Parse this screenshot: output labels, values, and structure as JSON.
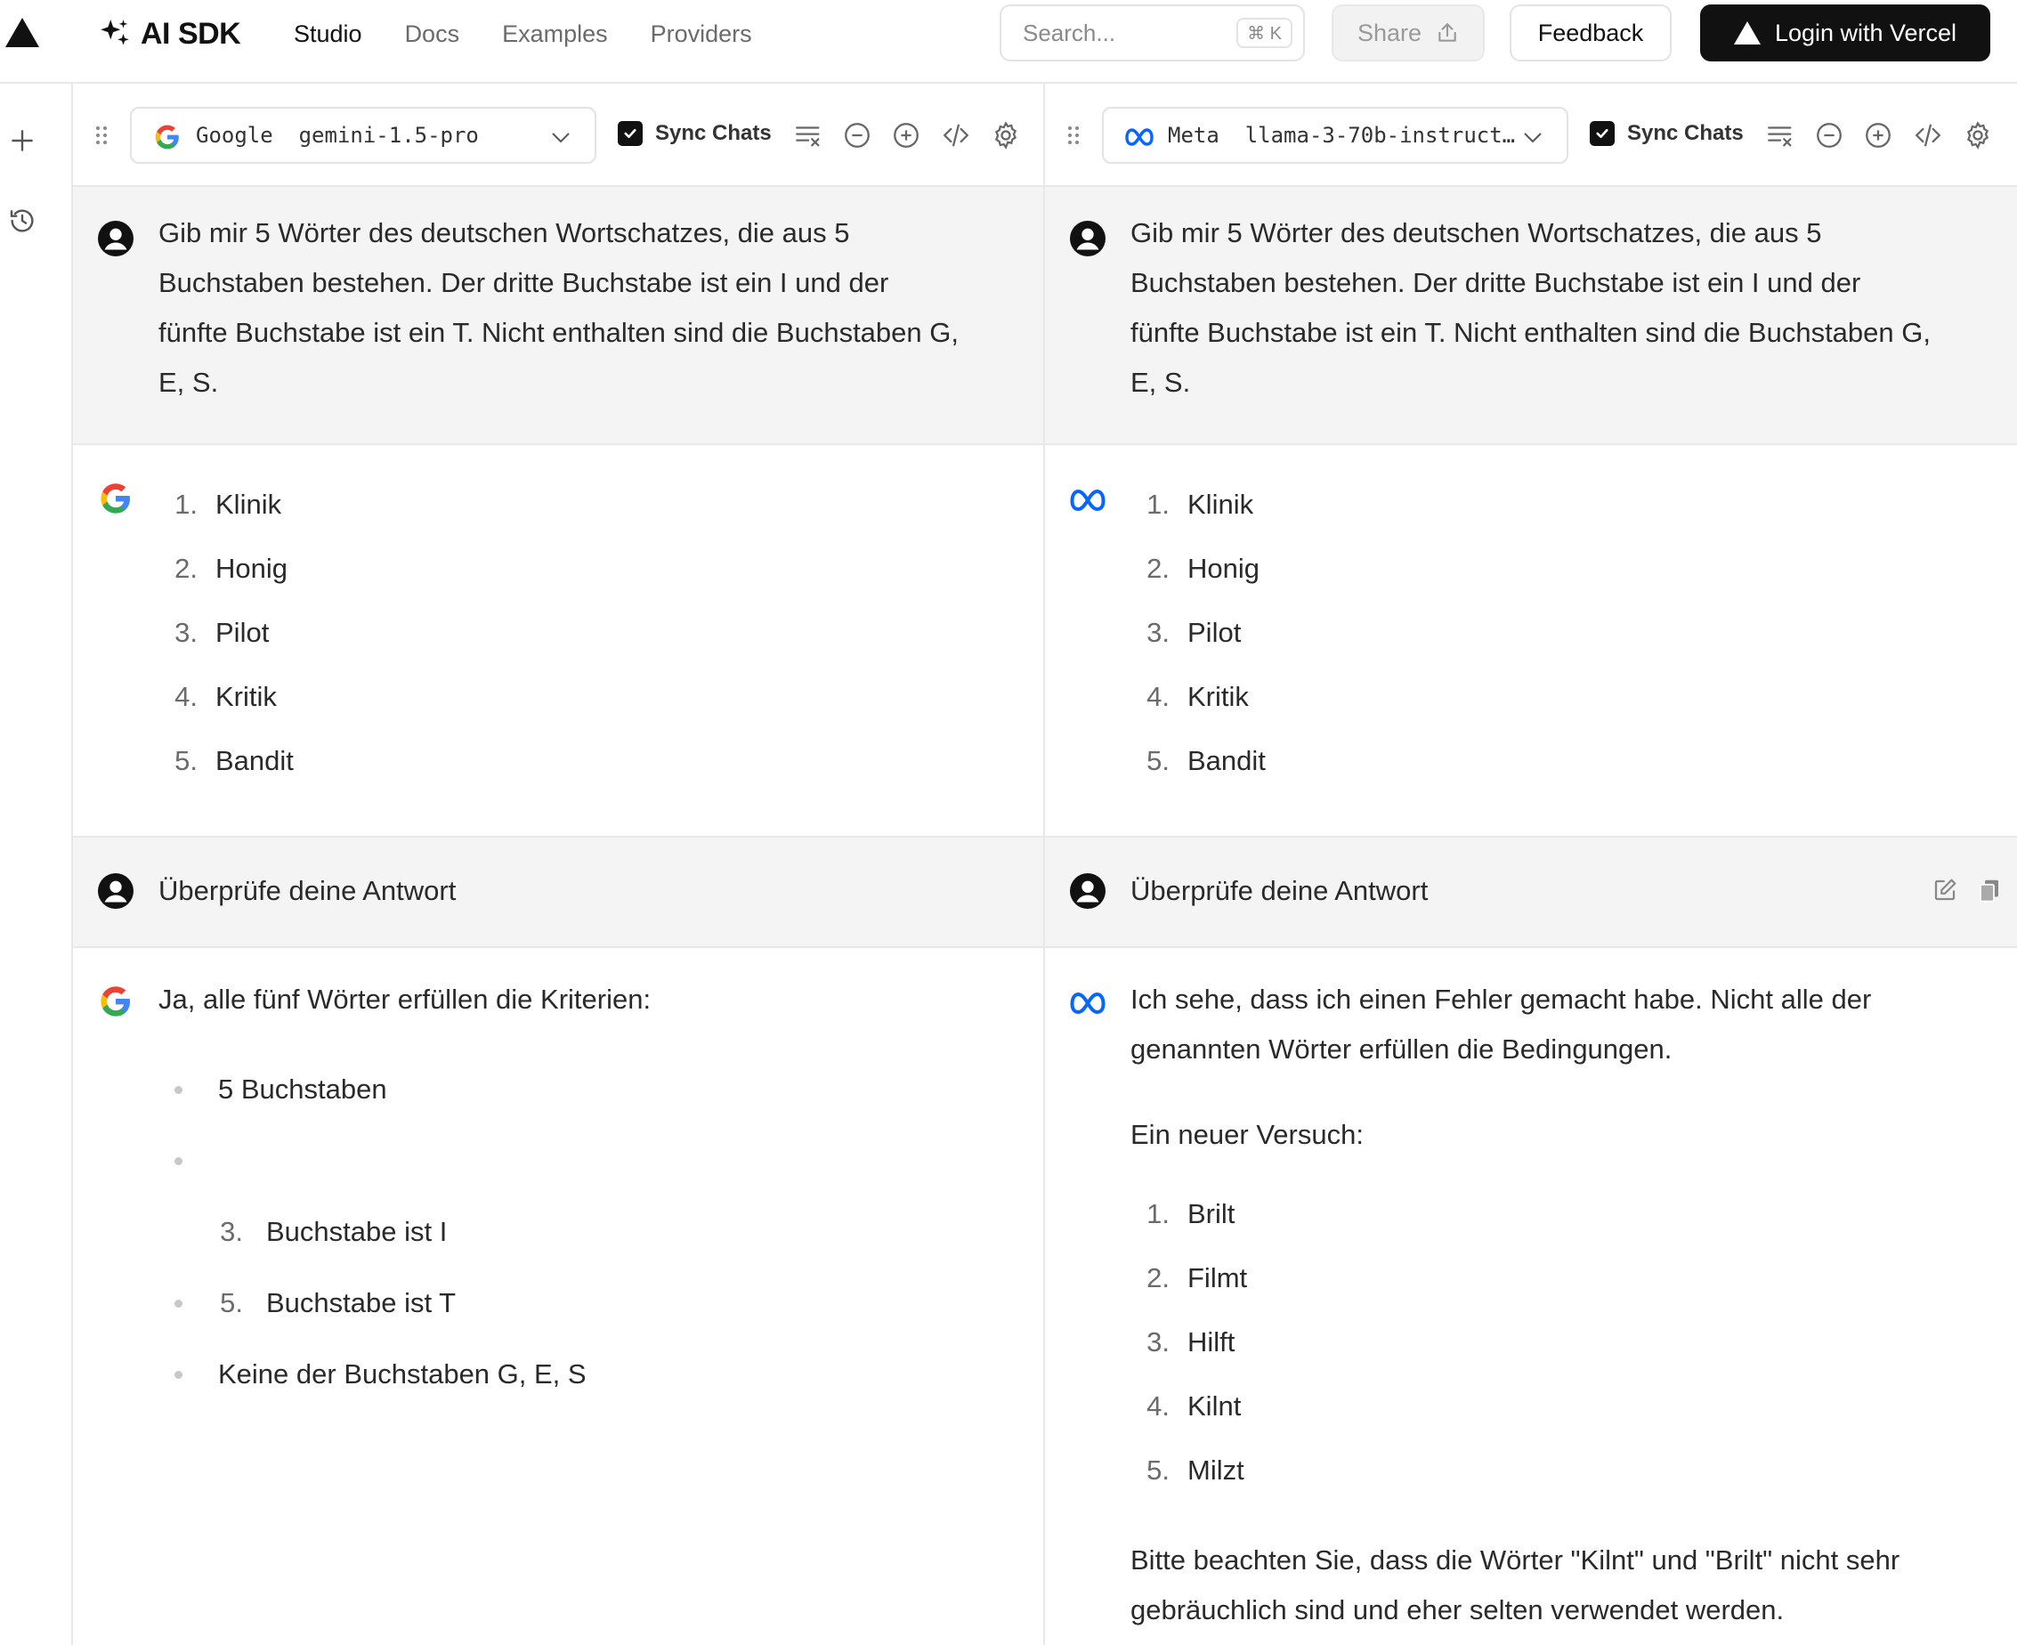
{
  "app": {
    "brand": "AI SDK",
    "nav": [
      "Studio",
      "Docs",
      "Examples",
      "Providers"
    ],
    "active_nav": "Studio",
    "search": {
      "placeholder": "Search...",
      "shortcut": "⌘ K"
    },
    "share_label": "Share",
    "feedback_label": "Feedback",
    "login_label": "Login with Vercel"
  },
  "panels": [
    {
      "provider": "Google",
      "model": "gemini-1.5-pro",
      "model_display": "Google  gemini-1.5-pro",
      "sync_label": "Sync Chats",
      "sync_checked": true,
      "messages": [
        {
          "role": "user",
          "text": "Gib mir 5 Wörter des deutschen Wortschatzes, die aus 5 Buchstaben bestehen. Der dritte Buchstabe ist ein I und der fünfte Buchstabe ist ein T. Nicht enthalten sind die Buchstaben G, E, S."
        },
        {
          "role": "assistant",
          "list": [
            {
              "n": "1.",
              "t": "Klinik"
            },
            {
              "n": "2.",
              "t": "Honig"
            },
            {
              "n": "3.",
              "t": "Pilot"
            },
            {
              "n": "4.",
              "t": "Kritik"
            },
            {
              "n": "5.",
              "t": "Bandit"
            }
          ]
        },
        {
          "role": "user",
          "text": "Überprüfe deine Antwort"
        },
        {
          "role": "assistant",
          "intro": "Ja, alle fünf Wörter erfüllen die Kriterien:",
          "bullets": [
            {
              "n": "",
              "t": "5 Buchstaben"
            },
            {
              "n": "",
              "t": ""
            },
            {
              "n": "3.",
              "t": "Buchstabe ist I",
              "nested": true
            },
            {
              "n": "5.",
              "t": "Buchstabe ist T"
            },
            {
              "n": "",
              "t": "Keine der Buchstaben G, E, S"
            }
          ]
        }
      ]
    },
    {
      "provider": "Meta",
      "model": "llama-3-70b-instruct",
      "model_display": "Meta  llama-3-70b-instruct…",
      "sync_label": "Sync Chats",
      "sync_checked": true,
      "messages": [
        {
          "role": "user",
          "text": "Gib mir 5 Wörter des deutschen Wortschatzes, die aus 5 Buchstaben bestehen. Der dritte Buchstabe ist ein I und der fünfte Buchstabe ist ein T. Nicht enthalten sind die Buchstaben G, E, S."
        },
        {
          "role": "assistant",
          "list": [
            {
              "n": "1.",
              "t": "Klinik"
            },
            {
              "n": "2.",
              "t": "Honig"
            },
            {
              "n": "3.",
              "t": "Pilot"
            },
            {
              "n": "4.",
              "t": "Kritik"
            },
            {
              "n": "5.",
              "t": "Bandit"
            }
          ]
        },
        {
          "role": "user",
          "text": "Überprüfe deine Antwort"
        },
        {
          "role": "assistant",
          "intro": "Ich sehe, dass ich einen Fehler gemacht habe. Nicht alle der genannten Wörter erfüllen die Bedingungen.",
          "sub": "Ein neuer Versuch:",
          "list": [
            {
              "n": "1.",
              "t": "Brilt"
            },
            {
              "n": "2.",
              "t": "Filmt"
            },
            {
              "n": "3.",
              "t": "Hilft"
            },
            {
              "n": "4.",
              "t": "Kilnt"
            },
            {
              "n": "5.",
              "t": "Milzt"
            }
          ],
          "outro": "Bitte beachten Sie, dass die Wörter \"Kilnt\" und \"Brilt\" nicht sehr gebräuchlich sind und eher selten verwendet werden."
        }
      ]
    }
  ],
  "colors": {
    "accent": "#111111",
    "user_bg": "#f4f4f4",
    "border": "#e8e8e8",
    "meta_blue": "#0866FF"
  }
}
